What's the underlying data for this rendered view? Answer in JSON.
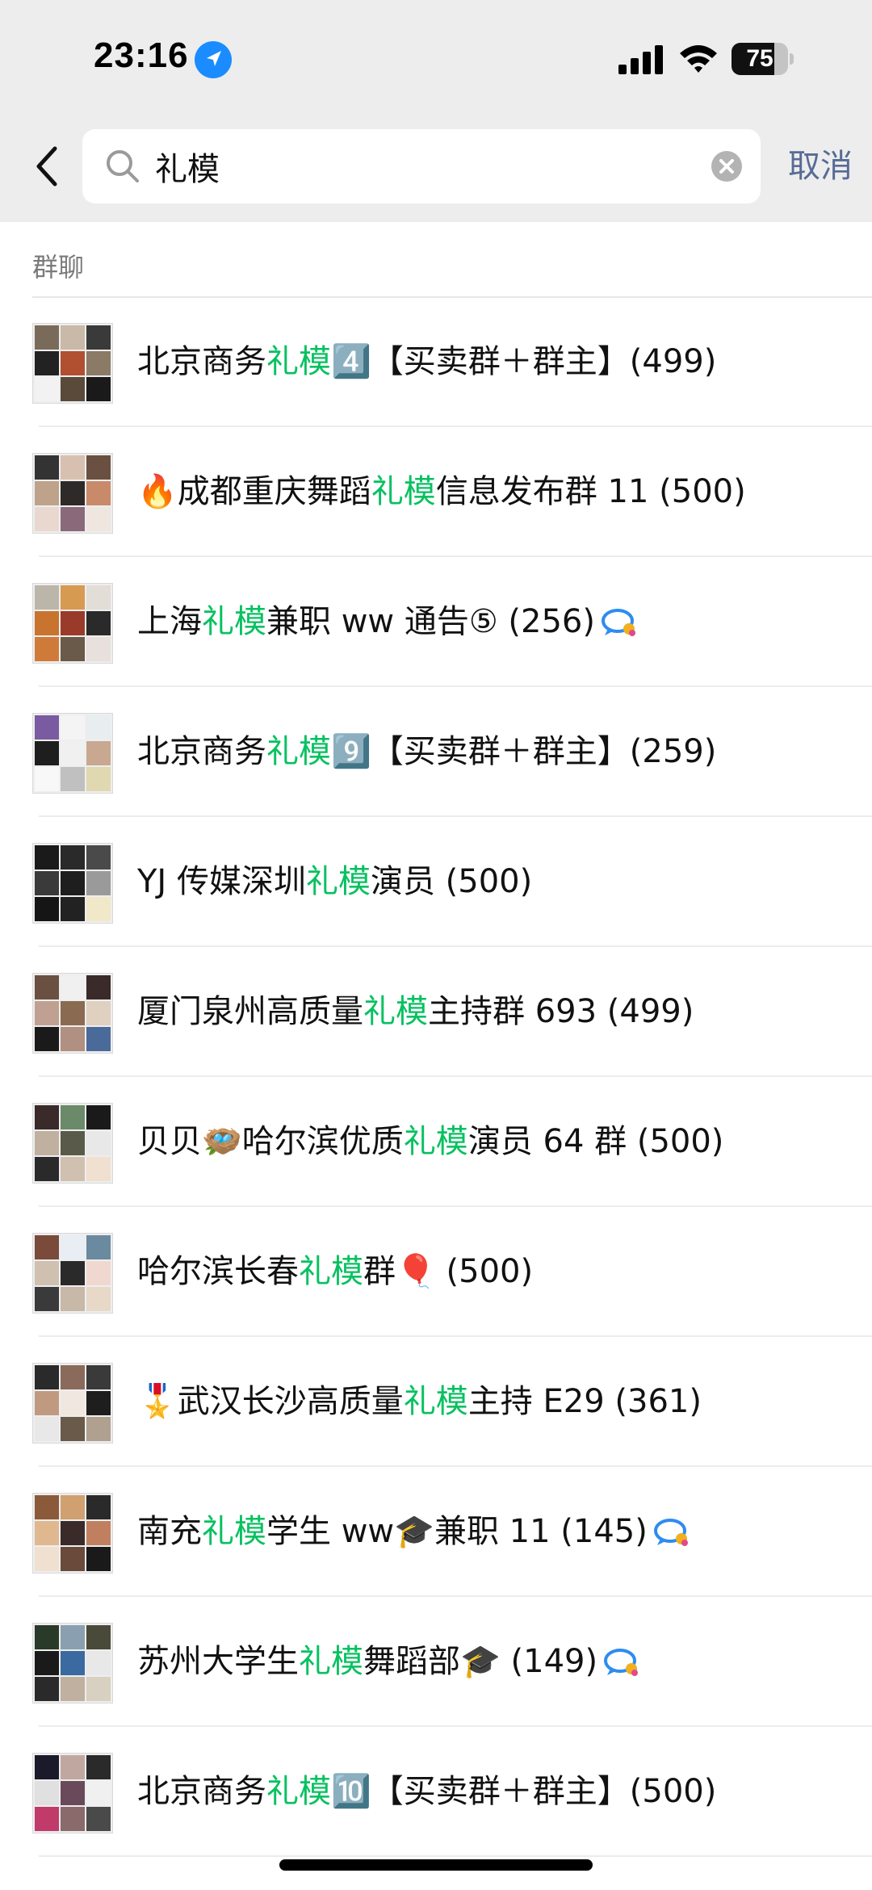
{
  "status_bar": {
    "time": "23:16",
    "battery_level": 75,
    "battery_text": "75",
    "icons": [
      "location-arrow-icon",
      "cellular-signal-icon",
      "wifi-icon",
      "battery-icon"
    ]
  },
  "search": {
    "query": "礼模",
    "cancel_label": "取消",
    "icons": [
      "back-chevron-icon",
      "search-icon",
      "clear-icon"
    ]
  },
  "section": {
    "title": "群聊"
  },
  "colors": {
    "highlight": "#07c160",
    "link": "#576b95",
    "header_background": "#ededed"
  },
  "groups": [
    {
      "prefix": "北京商务",
      "keyword": "礼模",
      "suffix": "4️⃣【买卖群＋群主】(499)",
      "bubble": false,
      "avatar": [
        "#7a6a5a",
        "#c9b9a8",
        "#3a3a3a",
        "#222",
        "#b05030",
        "#8a7a66",
        "#f2f2f2",
        "#5a4a3a",
        "#1a1a1a"
      ]
    },
    {
      "prefix": "🔥成都重庆舞蹈",
      "keyword": "礼模",
      "suffix": "信息发布群 11 (500)",
      "bubble": false,
      "avatar": [
        "#333",
        "#d8c0b0",
        "#6a5040",
        "#bfa28a",
        "#2e2a28",
        "#c98a6a",
        "#e8d8d0",
        "#8a6a7a",
        "#f0e6e0"
      ]
    },
    {
      "prefix": "上海",
      "keyword": "礼模",
      "suffix": "兼职 ww 通告⑤ (256)",
      "bubble": true,
      "avatar": [
        "#bcb6aa",
        "#d69a50",
        "#e2ddd6",
        "#c8742e",
        "#9a3a2a",
        "#2a2a2a",
        "#d07a3a",
        "#6a5a4a",
        "#e8e0dc"
      ]
    },
    {
      "prefix": "北京商务",
      "keyword": "礼模",
      "suffix": "9️⃣【买卖群＋群主】(259)",
      "bubble": false,
      "avatar": [
        "#7a5aa0",
        "#f4f4f4",
        "#e8eef0",
        "#1e1e1e",
        "#f0f0f0",
        "#c8a890",
        "#f8f8f8",
        "#c0c0c0",
        "#e0d8b0"
      ]
    },
    {
      "prefix": "YJ 传媒深圳",
      "keyword": "礼模",
      "suffix": "演员 (500)",
      "bubble": false,
      "avatar": [
        "#1a1a1a",
        "#2a2a2a",
        "#4a4a4a",
        "#3a3a3a",
        "#1e1e1e",
        "#9a9a9a",
        "#151515",
        "#222",
        "#f0e8c8"
      ]
    },
    {
      "prefix": "厦门泉州高质量",
      "keyword": "礼模",
      "suffix": "主持群 693 (499)",
      "bubble": false,
      "avatar": [
        "#6a5040",
        "#f0f0f0",
        "#3a2a2a",
        "#c0a090",
        "#8a6a50",
        "#e0d0c0",
        "#1a1a1a",
        "#b09080",
        "#4a6a9a"
      ]
    },
    {
      "prefix": "贝贝🪺哈尔滨优质",
      "keyword": "礼模",
      "suffix": "演员 64 群 (500)",
      "bubble": false,
      "avatar": [
        "#3a2a2a",
        "#6a8a6a",
        "#1a1a1a",
        "#c0b0a0",
        "#5a5a4a",
        "#e8e8e8",
        "#2a2a2a",
        "#d0c0b0",
        "#f0e0d0"
      ]
    },
    {
      "prefix": "哈尔滨长春",
      "keyword": "礼模",
      "suffix": "群🎈 (500)",
      "bubble": false,
      "avatar": [
        "#7a4a3a",
        "#e8eef4",
        "#6a8aa0",
        "#d0c0b0",
        "#2a2a2a",
        "#f0d8d0",
        "#3a3a3a",
        "#c8b8a8",
        "#e8d8c8"
      ]
    },
    {
      "prefix": "🎖️武汉长沙高质量",
      "keyword": "礼模",
      "suffix": "主持 E29 (361)",
      "bubble": false,
      "avatar": [
        "#2a2a2a",
        "#8a6a5a",
        "#3a3a3a",
        "#c09a80",
        "#f0e8e0",
        "#1e1e1e",
        "#e8e8e8",
        "#6a5a4a",
        "#b0a090"
      ]
    },
    {
      "prefix": "南充",
      "keyword": "礼模",
      "suffix": "学生 ww🎓兼职 11 (145)",
      "bubble": true,
      "avatar": [
        "#8a5a3a",
        "#d0a070",
        "#2a2a2a",
        "#e0b890",
        "#3a2a2a",
        "#c08060",
        "#f0e0d0",
        "#6a4a3a",
        "#1a1a1a"
      ]
    },
    {
      "prefix": "苏州大学生",
      "keyword": "礼模",
      "suffix": "舞蹈部🎓 (149)",
      "bubble": true,
      "avatar": [
        "#2a3a2a",
        "#8aa0b0",
        "#4a4a3a",
        "#1a1a1a",
        "#3a6aa0",
        "#e8e8e8",
        "#2a2a2a",
        "#c0b0a0",
        "#d8d0c0"
      ]
    },
    {
      "prefix": "北京商务",
      "keyword": "礼模",
      "suffix": "🔟【买卖群＋群主】(500)",
      "bubble": false,
      "avatar": [
        "#1a1a2a",
        "#c0a8a0",
        "#2a2a2a",
        "#e0e0e0",
        "#6a4a5a",
        "#f0f0f0",
        "#c03a6a",
        "#8a6a6a",
        "#4a4a4a"
      ]
    }
  ]
}
